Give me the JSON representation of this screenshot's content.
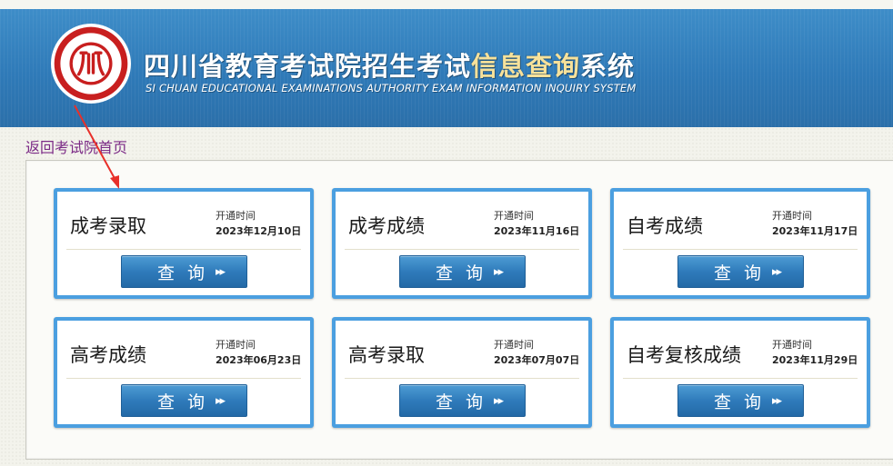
{
  "header": {
    "title_part1": "四川省教育考试院招生考试",
    "title_highlight": "信息查询",
    "title_part2": "系统",
    "subtitle_en": "SI CHUAN EDUCATIONAL EXAMINATIONS AUTHORITY EXAM INFORMATION INQUIRY SYSTEM",
    "logo_icon": "sichuan-exam-authority-seal"
  },
  "nav": {
    "back_link": "返回考试院首页"
  },
  "cards": [
    {
      "title": "成考录取",
      "open_label": "开通时间",
      "open_date": "2023年12月10日",
      "button": "查询"
    },
    {
      "title": "成考成绩",
      "open_label": "开通时间",
      "open_date": "2023年11月16日",
      "button": "查询"
    },
    {
      "title": "自考成绩",
      "open_label": "开通时间",
      "open_date": "2023年11月17日",
      "button": "查询"
    },
    {
      "title": "高考成绩",
      "open_label": "开通时间",
      "open_date": "2023年06月23日",
      "button": "查询"
    },
    {
      "title": "高考录取",
      "open_label": "开通时间",
      "open_date": "2023年07月07日",
      "button": "查询"
    },
    {
      "title": "自考复核成绩",
      "open_label": "开通时间",
      "open_date": "2023年11月29日",
      "button": "查询"
    }
  ],
  "colors": {
    "banner": "#2f7ab8",
    "card_border": "#4b9fe0",
    "button": "#2f7bbb",
    "annotation_arrow": "#e8302a",
    "link": "#7b2a86"
  }
}
